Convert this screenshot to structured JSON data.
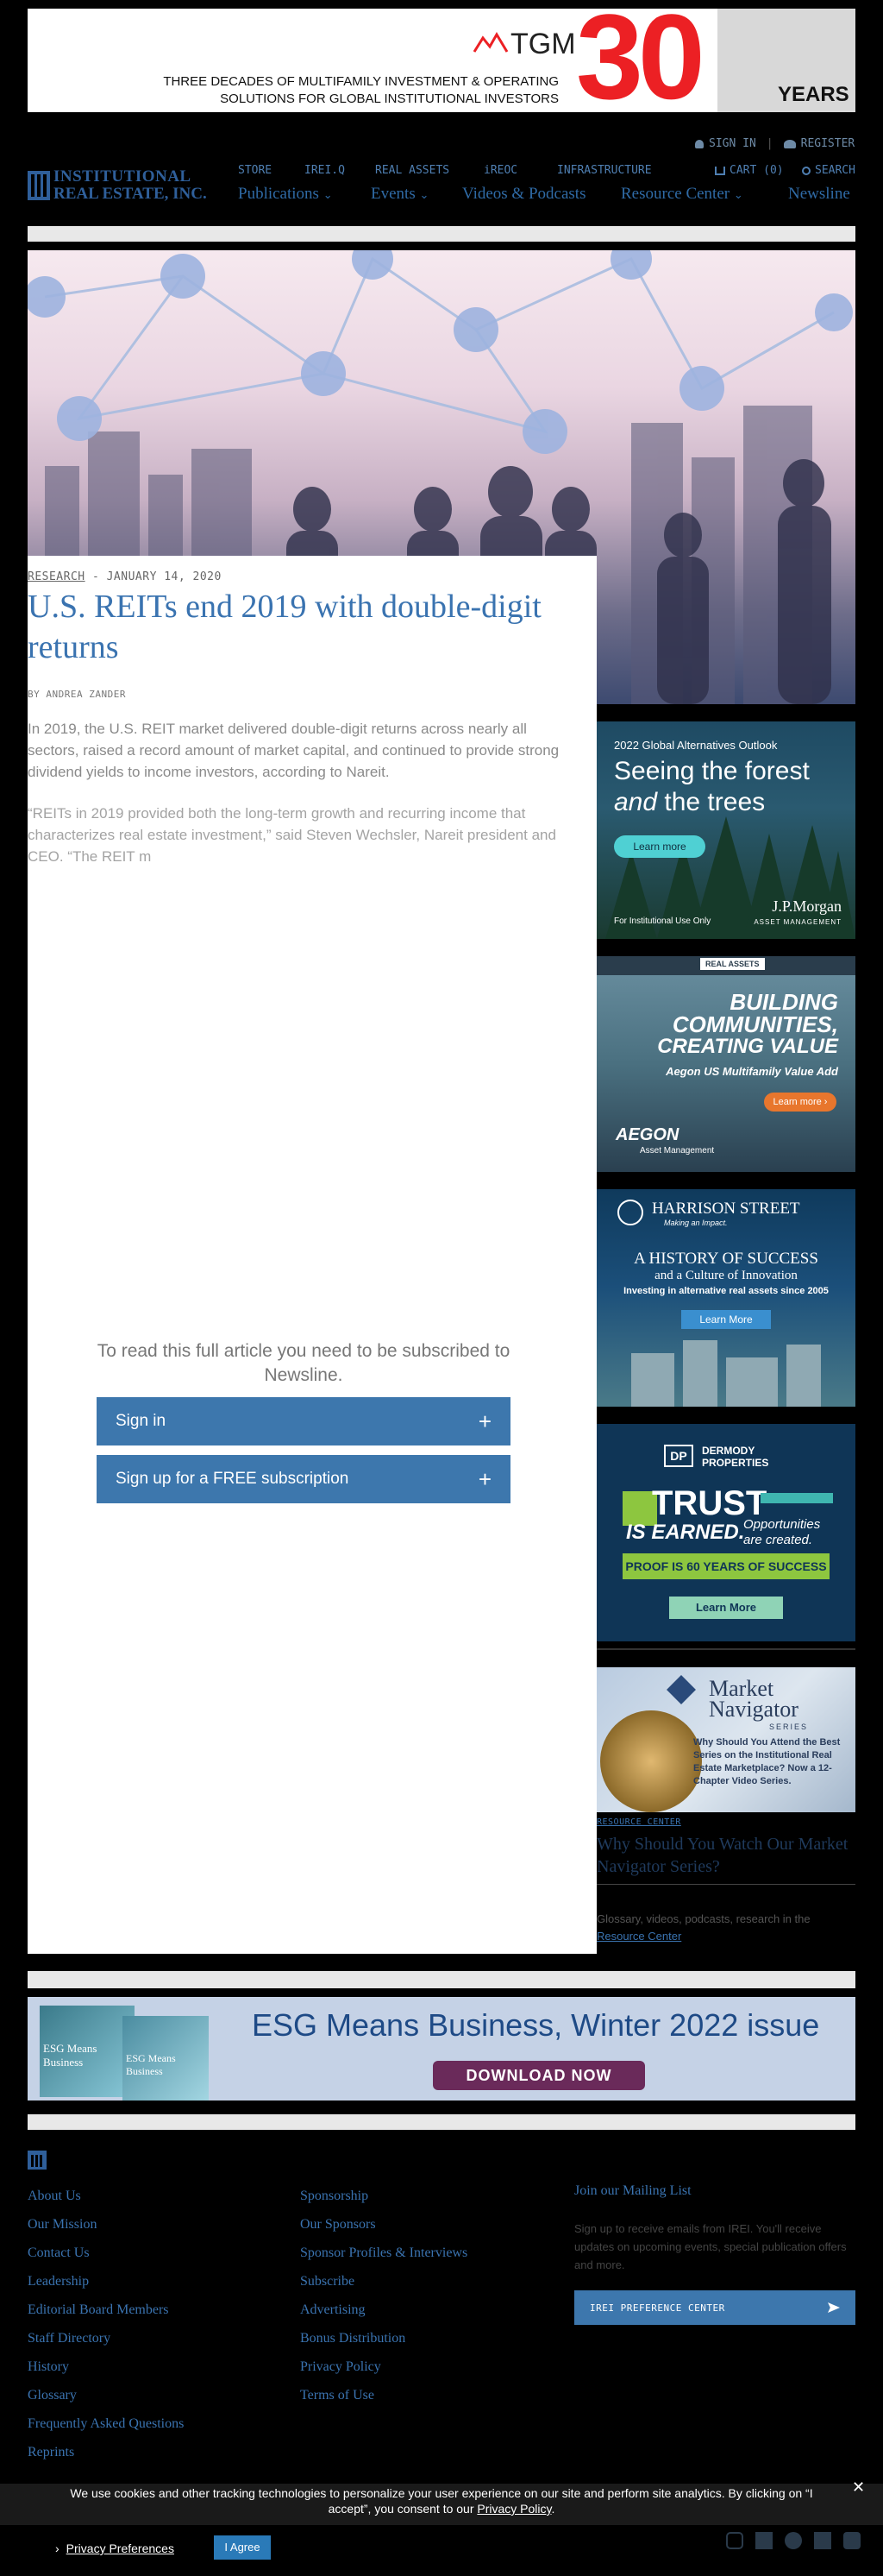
{
  "top_banner": {
    "brand": "TGM",
    "line1": "THREE DECADES OF MULTIFAMILY INVESTMENT & OPERATING",
    "line2": "SOLUTIONS FOR GLOBAL INSTITUTIONAL INVESTORS",
    "big_number": "30",
    "years": "YEARS"
  },
  "account": {
    "sign_in": "SIGN IN",
    "separator": "|",
    "register": "REGISTER"
  },
  "header": {
    "logo_line1": "INSTITUTIONAL",
    "logo_line2": "REAL ESTATE, INC.",
    "top_links": [
      "STORE",
      "IREI.Q",
      "REAL ASSETS",
      "iREOC",
      "INFRASTRUCTURE"
    ],
    "cart": "CART (0)",
    "search": "SEARCH",
    "main_links": [
      "Publications",
      "Events",
      "Videos & Podcasts",
      "Resource Center"
    ],
    "newsline": "Newsline"
  },
  "article": {
    "category": "RESEARCH",
    "date_sep": " - ",
    "date": "JANUARY 14, 2020",
    "title": "U.S. REITs end 2019 with double-digit returns",
    "byline": "BY ANDREA ZANDER",
    "para1": "In 2019, the U.S. REIT market delivered double-digit returns across nearly all sectors, raised a record amount of market capital, and continued to provide strong dividend yields to income investors, according to Nareit.",
    "para2": "“REITs in 2019 provided both the long-term growth and recurring income that characterizes real estate investment,” said Steven Wechsler, Nareit president and CEO. “The REIT m"
  },
  "paywall": {
    "message": "To read this full article you need to be subscribed to Newsline.",
    "sign_in": "Sign in",
    "signup": "Sign up for a FREE subscription",
    "plus": "+"
  },
  "ads": {
    "jpm": {
      "eyebrow": "2022 Global Alternatives Outlook",
      "headline1": "Seeing the forest",
      "headline2_em": "and",
      "headline2_rest": " the trees",
      "button": "Learn more",
      "footnote": "For Institutional Use Only",
      "brand": "J.P.Morgan",
      "brand_sub": "ASSET MANAGEMENT"
    },
    "aegon": {
      "tabs": [
        "REAL ASSETS"
      ],
      "line1": "BUILDING",
      "line2": "COMMUNITIES,",
      "line3": "CREATING VALUE",
      "sub": "Aegon US Multifamily Value Add",
      "button": "Learn more ›",
      "brand": "AEGON",
      "brand_sub": "Asset Management"
    },
    "harrison": {
      "brand": "HARRISON STREET",
      "tagline": "Making an Impact.",
      "line1": "A HISTORY OF SUCCESS",
      "line2": "and a Culture of Innovation",
      "line3": "Investing in alternative real assets since 2005",
      "button": "Learn More"
    },
    "dermody": {
      "logo": "DP",
      "brand1": "DERMODY",
      "brand2": "PROPERTIES",
      "trust1": "TRUST",
      "trust2": "IS EARNED.",
      "opp1": "Opportunities",
      "opp2": "are created.",
      "proof": "PROOF IS 60 YEARS OF SUCCESS",
      "button": "Learn More"
    },
    "navigator": {
      "title1": "Market",
      "title2": "Navigator",
      "series": "SERIES",
      "copy": "Why Should You Attend the Best Series on the Institutional Real Estate Marketplace? Now a 12-Chapter Video Series."
    }
  },
  "resource_center": {
    "label": "RESOURCE CENTER",
    "title": "Why Should You Watch Our Market Navigator Series?",
    "desc": "Glossary, videos, podcasts, research in the",
    "link": "Resource Center"
  },
  "esg_banner": {
    "headline": "ESG Means Business, Winter 2022 issue",
    "button": "DOWNLOAD NOW",
    "cover_title": "ESG Means Business"
  },
  "footer": {
    "col1": [
      "About Us",
      "Our Mission",
      "Contact Us",
      "Leadership",
      "Editorial Board Members",
      "Staff Directory",
      "History",
      "Glossary",
      "Frequently Asked Questions",
      "Reprints"
    ],
    "col2": [
      "Sponsorship",
      "Our Sponsors",
      "Sponsor Profiles & Interviews",
      "Subscribe",
      "Advertising",
      "Bonus Distribution",
      "Privacy Policy",
      "Terms of Use"
    ],
    "mailing_title": "Join our Mailing List",
    "mailing_text": "Sign up to receive emails from IREI. You'll receive updates on upcoming events, special publication offers and more.",
    "preference_button": "IREI PREFERENCE CENTER"
  },
  "cookie": {
    "text": "We use cookies and other tracking technologies to personalize your user experience on our site and perform site analytics. By clicking on “I accept”, you consent to our",
    "policy_link": "Privacy Policy",
    "period": ".",
    "prefs": "Privacy Preferences",
    "accept": "I Agree",
    "close": "✕"
  }
}
